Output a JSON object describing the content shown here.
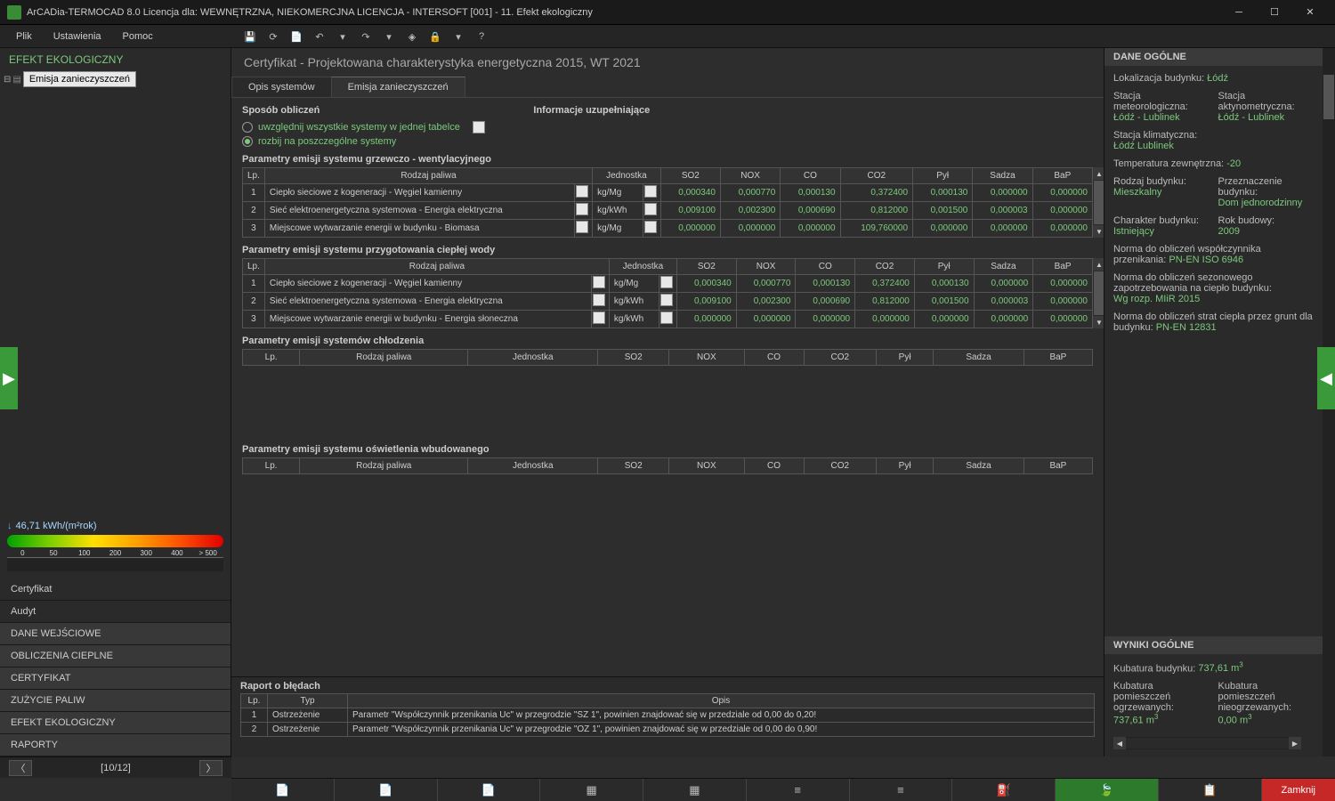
{
  "window": {
    "title": "ArCADia-TERMOCAD 8.0 Licencja dla: WEWNĘTRZNA, NIEKOMERCJNA LICENCJA - INTERSOFT [001] - 11. Efekt ekologiczny"
  },
  "menu": {
    "file": "Plik",
    "settings": "Ustawienia",
    "help": "Pomoc"
  },
  "sidebar": {
    "header": "EFEKT EKOLOGICZNY",
    "tree_node": "Emisja zanieczyszczeń",
    "gauge_value": "46,71 kWh/(m²rok)",
    "gauge_ticks": [
      "0",
      "50",
      "100",
      "200",
      "300",
      "400",
      "> 500"
    ],
    "items": [
      "Certyfikat",
      "Audyt",
      "DANE WEJŚCIOWE",
      "OBLICZENIA CIEPLNE",
      "CERTYFIKAT",
      "ZUŻYCIE PALIW",
      "EFEKT EKOLOGICZNY",
      "RAPORTY"
    ]
  },
  "pager": {
    "count": "[10/12]"
  },
  "main": {
    "title": "Certyfikat - Projektowana charakterystyka energetyczna 2015, WT 2021",
    "tabs": [
      "Opis systemów",
      "Emisja zanieczyszczeń"
    ],
    "active_tab": 1,
    "method_label": "Sposób obliczeń",
    "info_label": "Informacje uzupełniające",
    "radio1": "uwzględnij wszystkie systemy w jednej tabelce",
    "radio2": "rozbij na poszczególne systemy",
    "sections": {
      "heat": "Parametry emisji systemu grzewczo - wentylacyjnego",
      "hotwater": "Parametry emisji systemu przygotowania ciepłej wody",
      "cooling": "Parametry emisji systemów chłodzenia",
      "lighting": "Parametry emisji systemu oświetlenia wbudowanego"
    },
    "columns": [
      "Lp.",
      "Rodzaj paliwa",
      "Jednostka",
      "SO2",
      "NOX",
      "CO",
      "CO2",
      "Pył",
      "Sadza",
      "BaP"
    ],
    "heat_rows": [
      {
        "lp": "1",
        "fuel": "Ciepło sieciowe z kogeneracji - Węgiel kamienny",
        "unit": "kg/Mg",
        "so2": "0,000340",
        "nox": "0,000770",
        "co": "0,000130",
        "co2": "0,372400",
        "pyl": "0,000130",
        "sadza": "0,000000",
        "bap": "0,000000"
      },
      {
        "lp": "2",
        "fuel": "Sieć elektroenergetyczna systemowa - Energia elektryczna",
        "unit": "kg/kWh",
        "so2": "0,009100",
        "nox": "0,002300",
        "co": "0,000690",
        "co2": "0,812000",
        "pyl": "0,001500",
        "sadza": "0,000003",
        "bap": "0,000000"
      },
      {
        "lp": "3",
        "fuel": "Miejscowe wytwarzanie energii w budynku - Biomasa",
        "unit": "kg/Mg",
        "so2": "0,000000",
        "nox": "0,000000",
        "co": "0,000000",
        "co2": "109,760000",
        "pyl": "0,000000",
        "sadza": "0,000000",
        "bap": "0,000000"
      }
    ],
    "hotwater_rows": [
      {
        "lp": "1",
        "fuel": "Ciepło sieciowe z kogeneracji - Węgiel kamienny",
        "unit": "kg/Mg",
        "so2": "0,000340",
        "nox": "0,000770",
        "co": "0,000130",
        "co2": "0,372400",
        "pyl": "0,000130",
        "sadza": "0,000000",
        "bap": "0,000000"
      },
      {
        "lp": "2",
        "fuel": "Sieć elektroenergetyczna systemowa - Energia elektryczna",
        "unit": "kg/kWh",
        "so2": "0,009100",
        "nox": "0,002300",
        "co": "0,000690",
        "co2": "0,812000",
        "pyl": "0,001500",
        "sadza": "0,000003",
        "bap": "0,000000"
      },
      {
        "lp": "3",
        "fuel": "Miejscowe wytwarzanie energii w budynku - Energia słoneczna",
        "unit": "kg/kWh",
        "so2": "0,000000",
        "nox": "0,000000",
        "co": "0,000000",
        "co2": "0,000000",
        "pyl": "0,000000",
        "sadza": "0,000000",
        "bap": "0,000000"
      }
    ]
  },
  "right": {
    "hdr1": "DANE OGÓLNE",
    "loc_l": "Lokalizacja budynku:",
    "loc_v": "Łódź",
    "st_meteo_l": "Stacja meteorologiczna:",
    "st_meteo_v": "Łódź - Lublinek",
    "st_akt_l": "Stacja aktynometryczna:",
    "st_akt_v": "Łódź - Lublinek",
    "st_klim_l": "Stacja klimatyczna:",
    "st_klim_v": "Łódź Lublinek",
    "temp_l": "Temperatura zewnętrzna:",
    "temp_v": "-20",
    "rodzaj_l": "Rodzaj budynku:",
    "rodzaj_v": "Mieszkalny",
    "przezn_l": "Przeznaczenie budynku:",
    "przezn_v": "Dom jednorodzinny",
    "char_l": "Charakter budynku:",
    "char_v": "Istniejący",
    "rok_l": "Rok budowy:",
    "rok_v": "2009",
    "norma1_l": "Norma do obliczeń współczynnika przenikania:",
    "norma1_v": "PN-EN ISO 6946",
    "norma2_l": "Norma do obliczeń sezonowego zapotrzebowania na ciepło budynku:",
    "norma2_v": "Wg rozp. MIiR 2015",
    "norma3_l": "Norma do obliczeń strat ciepła przez grunt dla budynku:",
    "norma3_v": "PN-EN 12831",
    "hdr2": "WYNIKI OGÓLNE",
    "kub_l": "Kubatura budynku:",
    "kub_v": "737,61 m",
    "kub_sup": "3",
    "kubogrz_l": "Kubatura pomieszczeń ogrzewanych:",
    "kubogrz_v": "737,61 m",
    "kubogrz_sup": "3",
    "kubnieogrz_l": "Kubatura pomieszczeń nieogrzewanych:",
    "kubnieogrz_v": "0,00 m",
    "kubnieogrz_sup": "3"
  },
  "errors": {
    "hdr": "Raport o błędach",
    "cols": [
      "Lp.",
      "Typ",
      "Opis"
    ],
    "rows": [
      {
        "lp": "1",
        "typ": "Ostrzeżenie",
        "opis": "Parametr \"Współczynnik przenikania Uc\" w przegrodzie \"SZ 1\", powinien znajdować się w przedziale od 0,00 do 0,20!"
      },
      {
        "lp": "2",
        "typ": "Ostrzeżenie",
        "opis": "Parametr \"Współczynnik przenikania Uc\" w przegrodzie \"OZ 1\", powinien znajdować się w przedziale od 0,00 do 0,90!"
      }
    ]
  },
  "close_btn": "Zamknij"
}
